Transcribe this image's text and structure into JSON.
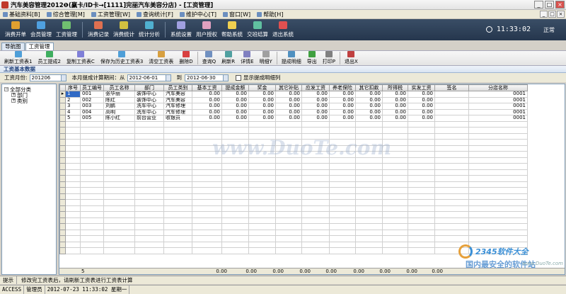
{
  "window": {
    "title": "汽车美容管理2012❶(赢卡/ID卡→[1111]完丽汽车美容分店) - [工资管理]",
    "controls": [
      "_",
      "□",
      "×"
    ]
  },
  "menu": [
    {
      "label": "基础资料[B]",
      "icon": "data-icon"
    },
    {
      "label": "综合管理[M]",
      "icon": "manage-icon"
    },
    {
      "label": "工资管理[W]",
      "icon": "salary-icon"
    },
    {
      "label": "查询统计[F]",
      "icon": "query-icon"
    },
    {
      "label": "维护中心[T]",
      "icon": "maintain-icon"
    },
    {
      "label": "窗口[W]",
      "icon": "window-icon"
    },
    {
      "label": "帮助[H]",
      "icon": "help-icon"
    }
  ],
  "bigtoolbar": {
    "groups": [
      [
        {
          "label": "消费开单",
          "color": "#e0a030"
        },
        {
          "label": "会员管理",
          "color": "#4fa0e0"
        },
        {
          "label": "工资管理",
          "color": "#70c070"
        }
      ],
      [
        {
          "label": "消费记录",
          "color": "#e07050"
        },
        {
          "label": "消费统计",
          "color": "#d0c040"
        },
        {
          "label": "统计分析",
          "color": "#50b0d0"
        }
      ],
      [
        {
          "label": "系统设置",
          "color": "#a0a0e0"
        },
        {
          "label": "用户授权",
          "color": "#e0a0c0"
        },
        {
          "label": "帮助系统",
          "color": "#f0d050"
        },
        {
          "label": "交班结算",
          "color": "#60c0a0"
        },
        {
          "label": "退出系统",
          "color": "#e05050"
        }
      ]
    ],
    "clock": "11:33:02",
    "mode": "正常"
  },
  "tabs": [
    {
      "label": "导航图",
      "active": false
    },
    {
      "label": "工资管理",
      "active": true
    }
  ],
  "toolbar": [
    {
      "label": "刷新工资表1",
      "color": "#4f9fd8"
    },
    {
      "label": "员工提成2",
      "color": "#3fae5f"
    },
    {
      "label": "复制工资表C",
      "color": "#7f7fd8"
    },
    {
      "label": "保存为历史工资表3",
      "color": "#4f9fd8"
    },
    {
      "label": "清空工资表",
      "color": "#d8a040"
    },
    {
      "label": "删除D",
      "color": "#d84040"
    },
    {
      "label": "查询Q",
      "color": "#7090c0"
    },
    {
      "label": "刷新R",
      "color": "#50a0a0"
    },
    {
      "label": "详情E",
      "color": "#8080c0"
    },
    {
      "label": "明细Y",
      "color": "#a0a0a0"
    },
    {
      "label": "提成明细",
      "color": "#5090c0"
    },
    {
      "label": "导出",
      "color": "#40a040"
    },
    {
      "label": "打印P",
      "color": "#808080"
    },
    {
      "label": "退出X",
      "color": "#c04040"
    }
  ],
  "section_title": "工资基本数据",
  "filter": {
    "month_label": "工资月份:",
    "month_value": "201206",
    "period_label": "本月提成计算期间：从",
    "from_date": "2012-06-01",
    "to_label": "到",
    "to_date": "2012-06-30",
    "checkbox_label": "显示提成明细列"
  },
  "tree": {
    "root": "全部分类",
    "children": [
      "部门",
      "类别"
    ]
  },
  "table": {
    "columns": [
      "序号",
      "员工编号",
      "员工名称",
      "部门",
      "员工类别",
      "基本工资",
      "提成金额",
      "奖金",
      "其它补贴",
      "应发工资",
      "养老保险",
      "其它扣款",
      "所得税",
      "实发工资",
      "签名",
      "分店名称"
    ],
    "rows": [
      [
        "1",
        "001",
        "张华丽",
        "装饰中心",
        "汽车美容",
        "0.00",
        "0.00",
        "0.00",
        "0.00",
        "0.00",
        "0.00",
        "0.00",
        "0.00",
        "0.00",
        "",
        "0001"
      ],
      [
        "2",
        "002",
        "陈红",
        "装饰中心",
        "汽车美容",
        "0.00",
        "0.00",
        "0.00",
        "0.00",
        "0.00",
        "0.00",
        "0.00",
        "0.00",
        "0.00",
        "",
        "0001"
      ],
      [
        "3",
        "003",
        "刘鹏",
        "洗车中心",
        "汽车修理",
        "0.00",
        "0.00",
        "0.00",
        "0.00",
        "0.00",
        "0.00",
        "0.00",
        "0.00",
        "0.00",
        "",
        "0001"
      ],
      [
        "4",
        "004",
        "高明",
        "洗车中心",
        "汽车修理",
        "0.00",
        "0.00",
        "0.00",
        "0.00",
        "0.00",
        "0.00",
        "0.00",
        "0.00",
        "0.00",
        "",
        "0001"
      ],
      [
        "5",
        "005",
        "陈小红",
        "前台营业",
        "收银员",
        "0.00",
        "0.00",
        "0.00",
        "0.00",
        "0.00",
        "0.00",
        "0.00",
        "0.00",
        "0.00",
        "",
        "0001"
      ]
    ],
    "footer": {
      "count": "5",
      "totals": [
        "0.00",
        "0.00",
        "0.00",
        "0.00",
        "0.00",
        "0.00",
        "0.00",
        "0.00",
        "0.00"
      ]
    }
  },
  "hint": {
    "label": "提示",
    "text": "修改完工资表后，请刷新工资表进行工资表计算"
  },
  "status": [
    "ACCESS",
    "管理员",
    "2012-07-23 11:33:02 星期一"
  ],
  "watermarks": {
    "duote": "www.DuoTe.com",
    "logo": "2345软件大全",
    "slogan": "国内最安全的软件站",
    "duote_small": "www.DuoTe.com"
  }
}
